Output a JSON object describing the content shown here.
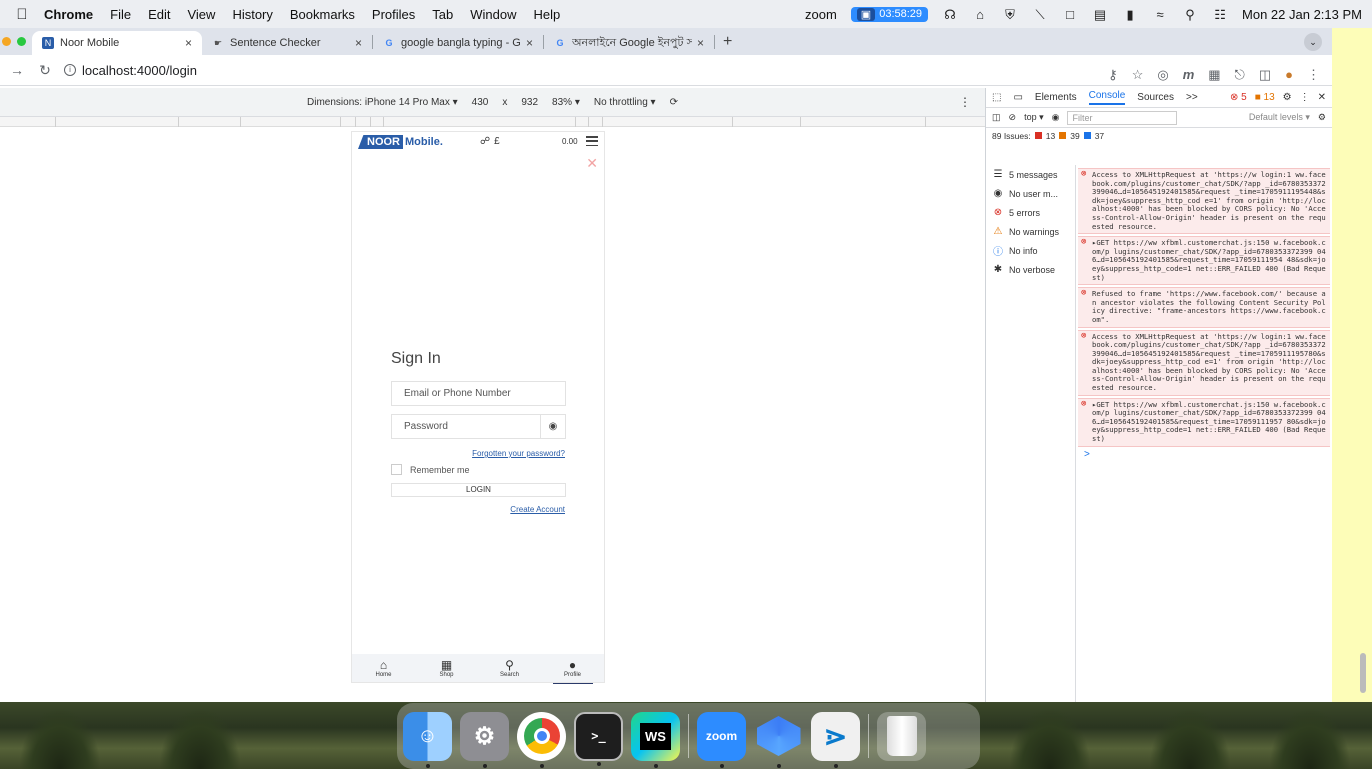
{
  "menubar": {
    "app": "Chrome",
    "items": [
      "File",
      "Edit",
      "View",
      "History",
      "Bookmarks",
      "Profiles",
      "Tab",
      "Window",
      "Help"
    ],
    "zoom_label": "zoom",
    "recording_time": "03:58:29",
    "datetime": "Mon 22 Jan  2:13 PM"
  },
  "tabs": [
    {
      "title": "Noor Mobile",
      "close": "×"
    },
    {
      "title": "Sentence Checker",
      "close": "×"
    },
    {
      "title": "google bangla typing - Google",
      "close": "×"
    },
    {
      "title": "অনলাইনে Google ইনপুট সরঞ্জাম",
      "close": "×"
    }
  ],
  "newtab": "+",
  "omnibar": {
    "url": "localhost:4000/login"
  },
  "device_toolbar": {
    "dimensions": "Dimensions: iPhone 14 Pro Max ▾",
    "width": "430",
    "times": "x",
    "height": "932",
    "zoom": "83% ▾",
    "throttling": "No throttling ▾"
  },
  "phone": {
    "logo_noor": "NOOR",
    "logo_mobile": "Mobile.",
    "currency": "£",
    "total": "0.00",
    "signin_title": "Sign In",
    "email_placeholder": "Email or Phone Number",
    "password_placeholder": "Password",
    "forgot": "Forgotten your password?",
    "remember": "Remember me",
    "login": "LOGIN",
    "create": "Create Account",
    "nav": [
      {
        "label": "Home",
        "icon": "⌂"
      },
      {
        "label": "Shop",
        "icon": "▦"
      },
      {
        "label": "Search",
        "icon": "⚲"
      },
      {
        "label": "Profile",
        "icon": "●"
      }
    ]
  },
  "devtools": {
    "tabs": [
      "Elements",
      "Console",
      "Sources",
      ">>"
    ],
    "active_tab": "Console",
    "errors": "5",
    "warnings": "13",
    "context": "top ▾",
    "filter_placeholder": "Filter",
    "levels": "Default levels ▾",
    "issues_label": "89 Issues:",
    "issues_red": "13",
    "issues_orange": "39",
    "issues_blue": "37",
    "sidebar": [
      {
        "icon": "☰",
        "label": "5 messages"
      },
      {
        "icon": "◉",
        "label": "No user m..."
      },
      {
        "icon": "⊗",
        "label": "5 errors"
      },
      {
        "icon": "⚠",
        "label": "No warnings"
      },
      {
        "icon": "ⓘ",
        "label": "No info"
      },
      {
        "icon": "✱",
        "label": "No verbose"
      }
    ],
    "messages": [
      "Access to XMLHttpRequest at 'https://w login:1 ww.facebook.com/plugins/customer_chat/SDK/?app _id=6780353372399046…d=105645192401585&request _time=1705911195448&sdk=joey&suppress_http_cod e=1' from origin 'http://localhost:4000' has been blocked by CORS policy: No 'Access-Control-Allow-Origin' header is present on the requested resource.",
      "▸GET https://ww xfbml.customerchat.js:150 w.facebook.com/p lugins/customer_chat/SDK/?app_id=6780353372399 046…d=105645192401585&request_time=17059111954 48&sdk=joey&suppress_http_code=1 net::ERR_FAILED 400 (Bad Request)",
      "Refused to frame 'https://www.facebook.com/' because an ancestor violates the following Content Security Policy directive: \"frame-ancestors https://www.facebook.com\".",
      "Access to XMLHttpRequest at 'https://w login:1 ww.facebook.com/plugins/customer_chat/SDK/?app _id=6780353372399046…d=105645192401585&request _time=1705911195780&sdk=joey&suppress_http_cod e=1' from origin 'http://localhost:4000' has been blocked by CORS policy: No 'Access-Control-Allow-Origin' header is present on the requested resource.",
      "▸GET https://ww xfbml.customerchat.js:150 w.facebook.com/p lugins/customer_chat/SDK/?app_id=6780353372399 046…d=105645192401585&request_time=17059111957 80&sdk=joey&suppress_http_code=1 net::ERR_FAILED 400 (Bad Request)"
    ],
    "prompt": ">"
  },
  "dock": {
    "apps": [
      "Finder",
      "System Settings",
      "Chrome",
      "Terminal",
      "WebStorm",
      "zoom",
      "Nuxt",
      "VS Code",
      "Trash"
    ],
    "zoom_label": "zoom",
    "ws_label": "WS"
  },
  "colors": {
    "brand": "#2a5da8",
    "error": "#d93025",
    "link": "#1a55b4"
  }
}
